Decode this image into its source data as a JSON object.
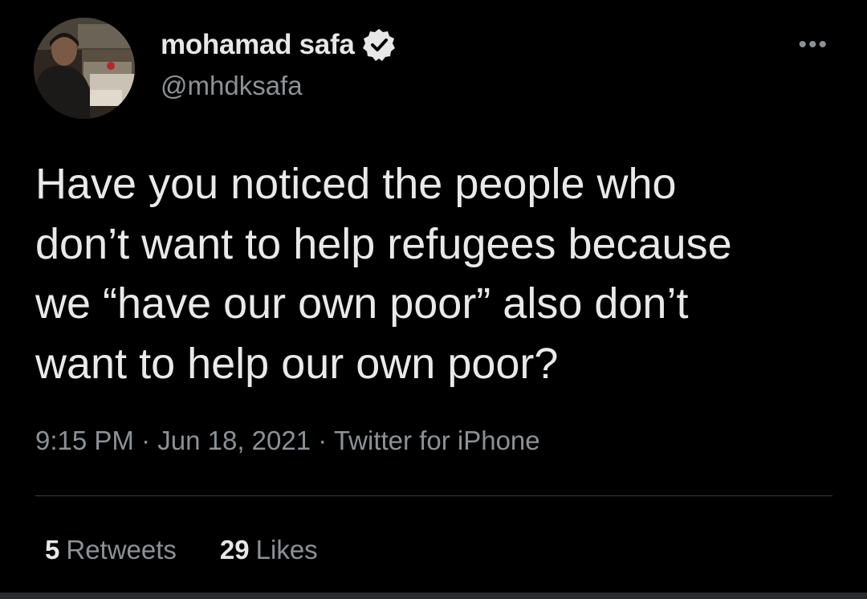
{
  "author": {
    "display_name": "mohamad safa",
    "handle": "@mhdksafa",
    "verified": true,
    "verified_icon": "verified-badge-icon"
  },
  "more_icon": "more-options-icon",
  "tweet": {
    "text": "Have you noticed the people who\ndon’t want to help refugees because\nwe “have our own poor” also don’t\nwant to help our own poor?",
    "time": "9:15 PM",
    "date": "Jun 18, 2021",
    "source": "Twitter for iPhone",
    "separator": "·"
  },
  "stats": {
    "retweets_count": "5",
    "retweets_label": "Retweets",
    "likes_count": "29",
    "likes_label": "Likes"
  },
  "colors": {
    "background": "#000000",
    "primary_text": "#e9e9e9",
    "secondary_text": "#8b9297",
    "divider": "#3b3f44"
  }
}
